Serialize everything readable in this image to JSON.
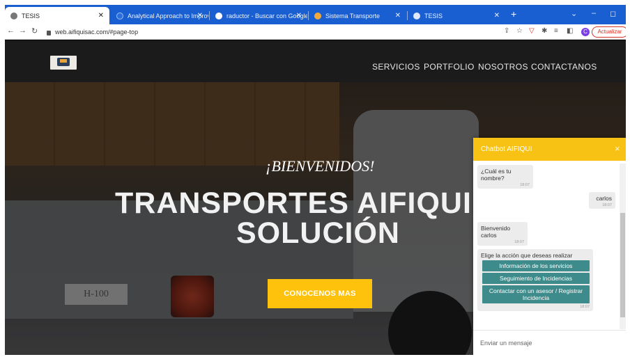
{
  "browser": {
    "tabs": [
      {
        "title": "TESIS",
        "active": true,
        "icon_color": "#555555"
      },
      {
        "title": "Analytical Approach to Improve",
        "active": false,
        "icon_color": "#2a6fdb"
      },
      {
        "title": "raductor - Buscar con Google",
        "active": false,
        "icon_color": "#ffffff"
      },
      {
        "title": "Sistema Transporte",
        "active": false,
        "icon_color": "#f2a93b"
      },
      {
        "title": "TESIS",
        "active": false,
        "icon_color": "#dfe8ff"
      }
    ],
    "new_tab": "+",
    "url": "web.aifiquisac.com/#page-top",
    "update_label": "Actualizar",
    "profile_initial": "C"
  },
  "site": {
    "nav": [
      "SERVICIOS",
      "PORTFOLIO",
      "NOSOTROS",
      "CONTACTANOS"
    ],
    "hero": {
      "welcome": "¡BIENVENIDOS!",
      "title_line1": "TRANSPORTES AIFIQUI",
      "title_line2": "SOLUCIÓN",
      "cta": "CONOCENOS MAS",
      "plate_text": "H-100"
    },
    "colors": {
      "accent": "#fec20d"
    }
  },
  "chatbot": {
    "title": "Chatbot AIFIQUI",
    "close": "×",
    "messages": [
      {
        "from": "bot",
        "text": "¿Cuál es tu nombre?",
        "time": "18:07"
      },
      {
        "from": "user",
        "text": "carlos",
        "time": "18:07"
      },
      {
        "from": "bot",
        "text": "Bienvenido carlos",
        "time": "18:07"
      },
      {
        "from": "bot",
        "text": "Elige la acción que deseas realizar",
        "time": "18:07"
      }
    ],
    "options": [
      "Información de los servicios",
      "Seguimiento de Incidencias",
      "Contactar con un asesor / Registrar Incidencia"
    ],
    "input_placeholder": "Enviar un mensaje",
    "colors": {
      "header": "#f7c214",
      "option": "#3e8b8b"
    }
  }
}
